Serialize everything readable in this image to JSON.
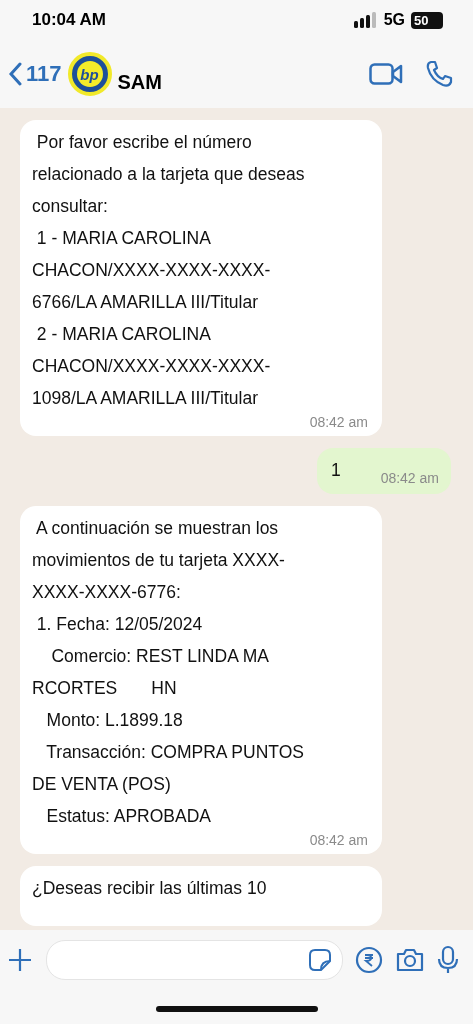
{
  "status_bar": {
    "time": "10:04 AM",
    "network": "5G",
    "battery": "50"
  },
  "header": {
    "back_count": "117",
    "avatar_text": "bp",
    "contact": "SAM"
  },
  "messages": [
    {
      "kind": "incoming",
      "text": " Por favor escribe el número\nrelacionado a la tarjeta que deseas\nconsultar:\n 1 - MARIA CAROLINA\nCHACON/XXXX-XXXX-XXXX-\n6766/LA AMARILLA III/Titular\n 2 - MARIA CAROLINA\nCHACON/XXXX-XXXX-XXXX-\n1098/LA AMARILLA III/Titular",
      "time": "08:42 am"
    },
    {
      "kind": "outgoing",
      "text": "1",
      "time": "08:42 am"
    },
    {
      "kind": "incoming",
      "text": " A continuación se muestran los\nmovimientos de tu tarjeta XXXX-\nXXXX-XXXX-6776:\n 1. Fecha: 12/05/2024\n    Comercio: REST LINDA MA\nRCORTES       HN\n   Monto: L.1899.18\n   Transacción: COMPRA PUNTOS\nDE VENTA (POS)\n   Estatus: APROBADA",
      "time": "08:42 am"
    },
    {
      "kind": "incoming",
      "text": "¿Deseas recibir las últimas 10"
    }
  ]
}
